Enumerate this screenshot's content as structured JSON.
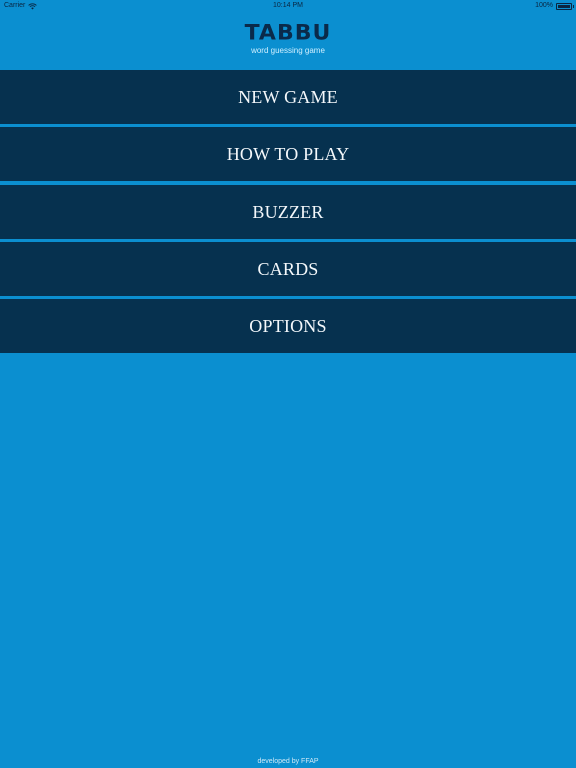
{
  "status_bar": {
    "carrier": "Carrier",
    "time": "10:14 PM",
    "battery_percent": "100%",
    "icons": [
      "wifi-icon",
      "battery-icon"
    ]
  },
  "header": {
    "title": "TABBU",
    "subtitle": "word guessing game"
  },
  "menu": {
    "items": [
      {
        "label": "NEW GAME"
      },
      {
        "label": "HOW TO PLAY"
      },
      {
        "label": "BUZZER"
      },
      {
        "label": "CARDS"
      },
      {
        "label": "OPTIONS"
      }
    ]
  },
  "footer": {
    "text": "developed by FFAP"
  },
  "colors": {
    "background": "#0b8fd0",
    "menu_item_background": "#06314f",
    "menu_item_text": "#f4f8fb",
    "logo_text": "#0a2a4a"
  }
}
